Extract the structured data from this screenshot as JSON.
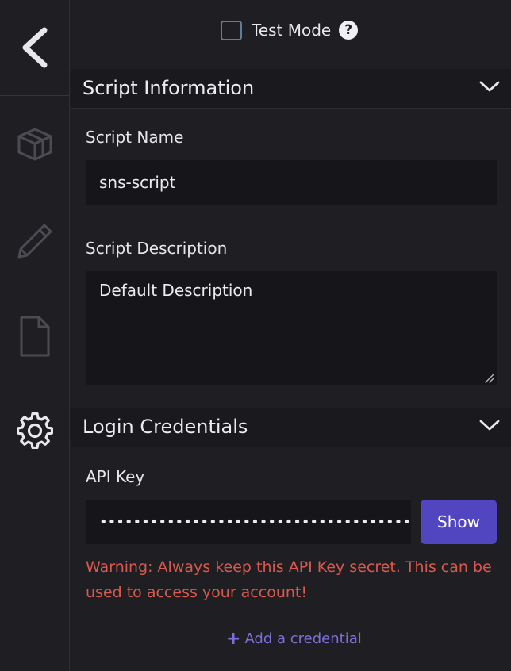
{
  "test_mode": {
    "label": "Test Mode",
    "checked": false,
    "help_icon": "question-circle-icon",
    "help_glyph": "?"
  },
  "sidebar": {
    "back_icon": "chevron-left-icon",
    "items": [
      {
        "icon": "cube-icon",
        "active": false
      },
      {
        "icon": "pencil-icon",
        "active": false
      },
      {
        "icon": "file-icon",
        "active": false
      },
      {
        "icon": "gear-icon",
        "active": true
      }
    ]
  },
  "script_info": {
    "title": "Script Information",
    "name_label": "Script Name",
    "name_value": "sns-script",
    "description_label": "Script Description",
    "description_value": "Default Description"
  },
  "login": {
    "title": "Login Credentials",
    "api_key_label": "API Key",
    "api_key_value": "••••••••••••••••••••••••••••••••••••••••",
    "show_label": "Show",
    "warning": "Warning: Always keep this API Key secret. This can be used to access your account!",
    "add_plus": "+",
    "add_label": "Add a credential"
  },
  "colors": {
    "background": "#1f1f23",
    "input_bg": "#16161a",
    "accent": "#5246c0",
    "link": "#7b70da",
    "warning": "#d9594e",
    "icon_inactive": "#4b4b52",
    "icon_active": "#e8e8ec"
  }
}
